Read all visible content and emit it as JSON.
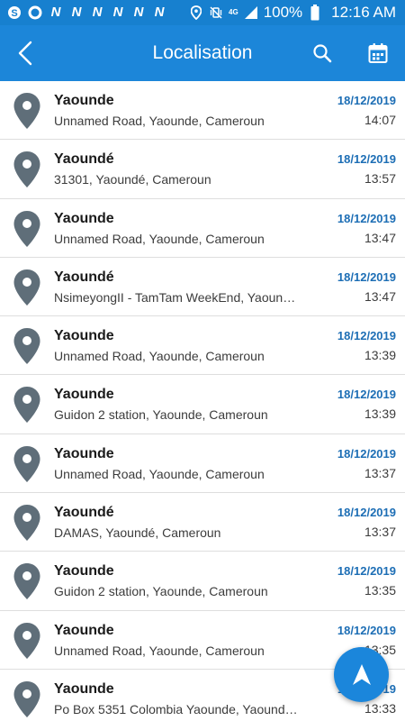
{
  "status_bar": {
    "notification_icons": [
      "skype-icon",
      "ring-icon",
      "n-icon",
      "n-icon",
      "n-icon",
      "n-icon",
      "n-icon",
      "n-icon"
    ],
    "notification_letter": "N",
    "network_label": "4G",
    "battery": "100%",
    "time": "12:16 AM"
  },
  "app_bar": {
    "title": "Localisation",
    "back_icon": "chevron-left-icon",
    "search_icon": "search-icon",
    "calendar_icon": "calendar-icon",
    "color": "#1c86d9"
  },
  "colors": {
    "status_bar": "#1780cf",
    "date": "#1d6eb5",
    "pin": "#5f6e79",
    "fab": "#1b86db"
  },
  "locations": [
    {
      "city": "Yaounde",
      "address": "Unnamed Road, Yaounde, Cameroun",
      "date": "18/12/2019",
      "time": "14:07"
    },
    {
      "city": "Yaoundé",
      "address": "31301, Yaoundé, Cameroun",
      "date": "18/12/2019",
      "time": "13:57"
    },
    {
      "city": "Yaounde",
      "address": "Unnamed Road, Yaounde, Cameroun",
      "date": "18/12/2019",
      "time": "13:47"
    },
    {
      "city": "Yaoundé",
      "address": "NsimeyongII - TamTam WeekEnd, Yaoundé,…",
      "date": "18/12/2019",
      "time": "13:47"
    },
    {
      "city": "Yaounde",
      "address": "Unnamed Road, Yaounde, Cameroun",
      "date": "18/12/2019",
      "time": "13:39"
    },
    {
      "city": "Yaounde",
      "address": "Guidon 2 station, Yaounde, Cameroun",
      "date": "18/12/2019",
      "time": "13:39"
    },
    {
      "city": "Yaounde",
      "address": "Unnamed Road, Yaounde, Cameroun",
      "date": "18/12/2019",
      "time": "13:37"
    },
    {
      "city": "Yaoundé",
      "address": "DAMAS, Yaoundé, Cameroun",
      "date": "18/12/2019",
      "time": "13:37"
    },
    {
      "city": "Yaounde",
      "address": "Guidon 2 station, Yaounde, Cameroun",
      "date": "18/12/2019",
      "time": "13:35"
    },
    {
      "city": "Yaounde",
      "address": "Unnamed Road, Yaounde, Cameroun",
      "date": "18/12/2019",
      "time": "13:35"
    },
    {
      "city": "Yaounde",
      "address": "Po Box 5351 Colombia Yaounde, Yaounde,…",
      "date": "18/12/2019",
      "time": "13:33"
    }
  ],
  "fab": {
    "icon": "navigation-arrow-icon"
  }
}
